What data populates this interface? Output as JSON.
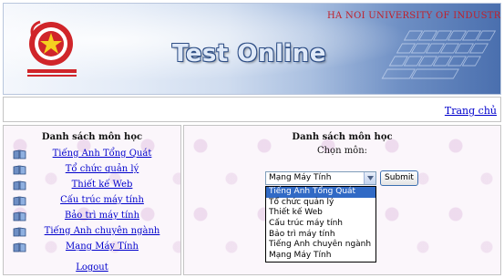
{
  "banner": {
    "university": "HA NOI UNIVERSITY OF INDUSTRY",
    "title": "Test Online"
  },
  "nav": {
    "home_link": "Trang chủ"
  },
  "left_panel": {
    "heading": "Danh sách môn học",
    "subjects": [
      "Tiếng Anh Tổng Quát",
      "Tổ chức quản lý",
      "Thiết kế Web",
      "Cấu trúc máy tính",
      "Bảo trì máy tính",
      "Tiếng Anh chuyên ngành",
      "Mạng Máy Tính"
    ],
    "logout": "Logout"
  },
  "right_panel": {
    "heading": "Danh sách môn học",
    "choose_label": "Chọn môn:",
    "selected_value": "Mạng Máy Tính",
    "submit_label": "Submit",
    "options": [
      "Tiếng Anh Tổng Quát",
      "Tổ chức quản lý",
      "Thiết kế Web",
      "Cấu trúc máy tính",
      "Bảo trì máy tính",
      "Tiếng Anh chuyên ngành",
      "Mạng Máy Tính"
    ],
    "highlighted_option": 0
  },
  "colors": {
    "link": "#0000cc",
    "university_text": "#c0202a",
    "highlight": "#316ac5",
    "panel_bg": "#fbf6fb"
  }
}
